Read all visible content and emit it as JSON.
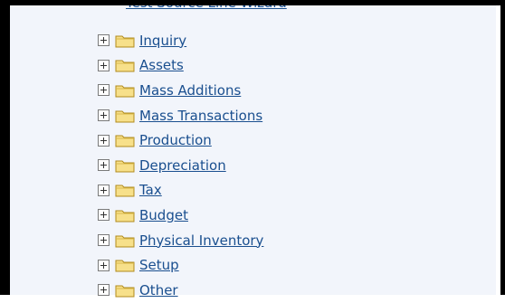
{
  "tree": {
    "cutoff_item_label": "Test Source Line Wizard",
    "items": [
      {
        "label": "Inquiry",
        "expander_icon": "plus-box-icon",
        "folder_icon": "folder-icon"
      },
      {
        "label": "Assets",
        "expander_icon": "plus-box-icon",
        "folder_icon": "folder-icon"
      },
      {
        "label": "Mass Additions",
        "expander_icon": "plus-box-icon",
        "folder_icon": "folder-icon"
      },
      {
        "label": "Mass Transactions",
        "expander_icon": "plus-box-icon",
        "folder_icon": "folder-icon"
      },
      {
        "label": "Production",
        "expander_icon": "plus-box-icon",
        "folder_icon": "folder-icon"
      },
      {
        "label": "Depreciation",
        "expander_icon": "plus-box-icon",
        "folder_icon": "folder-icon"
      },
      {
        "label": "Tax",
        "expander_icon": "plus-box-icon",
        "folder_icon": "folder-icon"
      },
      {
        "label": "Budget",
        "expander_icon": "plus-box-icon",
        "folder_icon": "folder-icon"
      },
      {
        "label": "Physical Inventory",
        "expander_icon": "plus-box-icon",
        "folder_icon": "folder-icon"
      },
      {
        "label": "Setup",
        "expander_icon": "plus-box-icon",
        "folder_icon": "folder-icon"
      },
      {
        "label": "Other",
        "expander_icon": "plus-box-icon",
        "folder_icon": "folder-icon"
      }
    ]
  },
  "colors": {
    "panel_background": "#f2f5fb",
    "link_color": "#1a4f8f",
    "folder_fill": "#f7e08a",
    "folder_stroke": "#b08a1c",
    "frame_border": "#000000"
  }
}
